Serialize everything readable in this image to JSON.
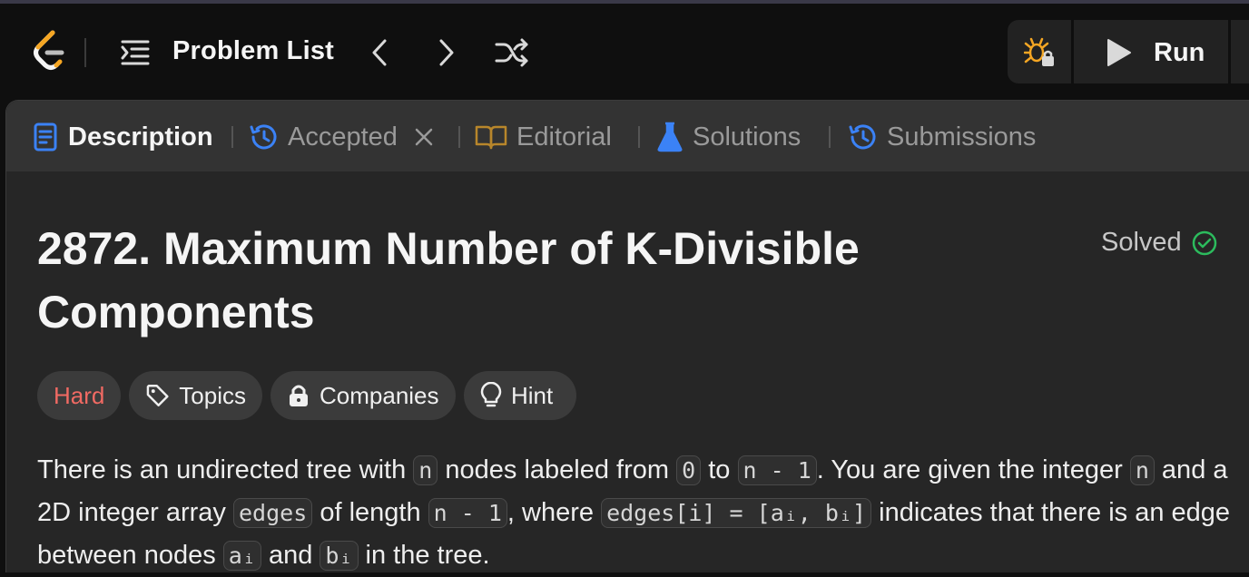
{
  "nav": {
    "problem_list_label": "Problem List",
    "run_label": "Run"
  },
  "tabs": [
    {
      "label": "Description",
      "icon": "description-icon",
      "active": true
    },
    {
      "label": "Accepted",
      "icon": "history-icon",
      "closable": true
    },
    {
      "label": "Editorial",
      "icon": "book-icon"
    },
    {
      "label": "Solutions",
      "icon": "flask-icon"
    },
    {
      "label": "Submissions",
      "icon": "history-icon"
    }
  ],
  "problem": {
    "title": "2872. Maximum Number of K-Divisible Components",
    "status": "Solved",
    "tags": {
      "difficulty": "Hard",
      "topics": "Topics",
      "companies": "Companies",
      "hint": "Hint"
    },
    "description": {
      "t1": "There is an undirected tree with ",
      "c1": "n",
      "t2": " nodes labeled from ",
      "c2": "0",
      "t3": " to ",
      "c3": "n - 1",
      "t4": ". You are given the integer ",
      "c4": "n",
      "t5": " and a 2D integer array ",
      "c5": "edges",
      "t6": " of length ",
      "c6": "n - 1",
      "t7": ", where ",
      "c7": "edges[i] = [aᵢ, bᵢ]",
      "t8": " indicates that there is an edge between nodes ",
      "c8": "aᵢ",
      "t9": " and ",
      "c9": "bᵢ",
      "t10": " in the tree."
    }
  },
  "colors": {
    "accent_blue": "#3b82f6",
    "difficulty_hard": "#f16a63",
    "solved_green": "#2cbb5d",
    "editorial_gold": "#b8862b",
    "debug_orange": "#f5a623"
  }
}
